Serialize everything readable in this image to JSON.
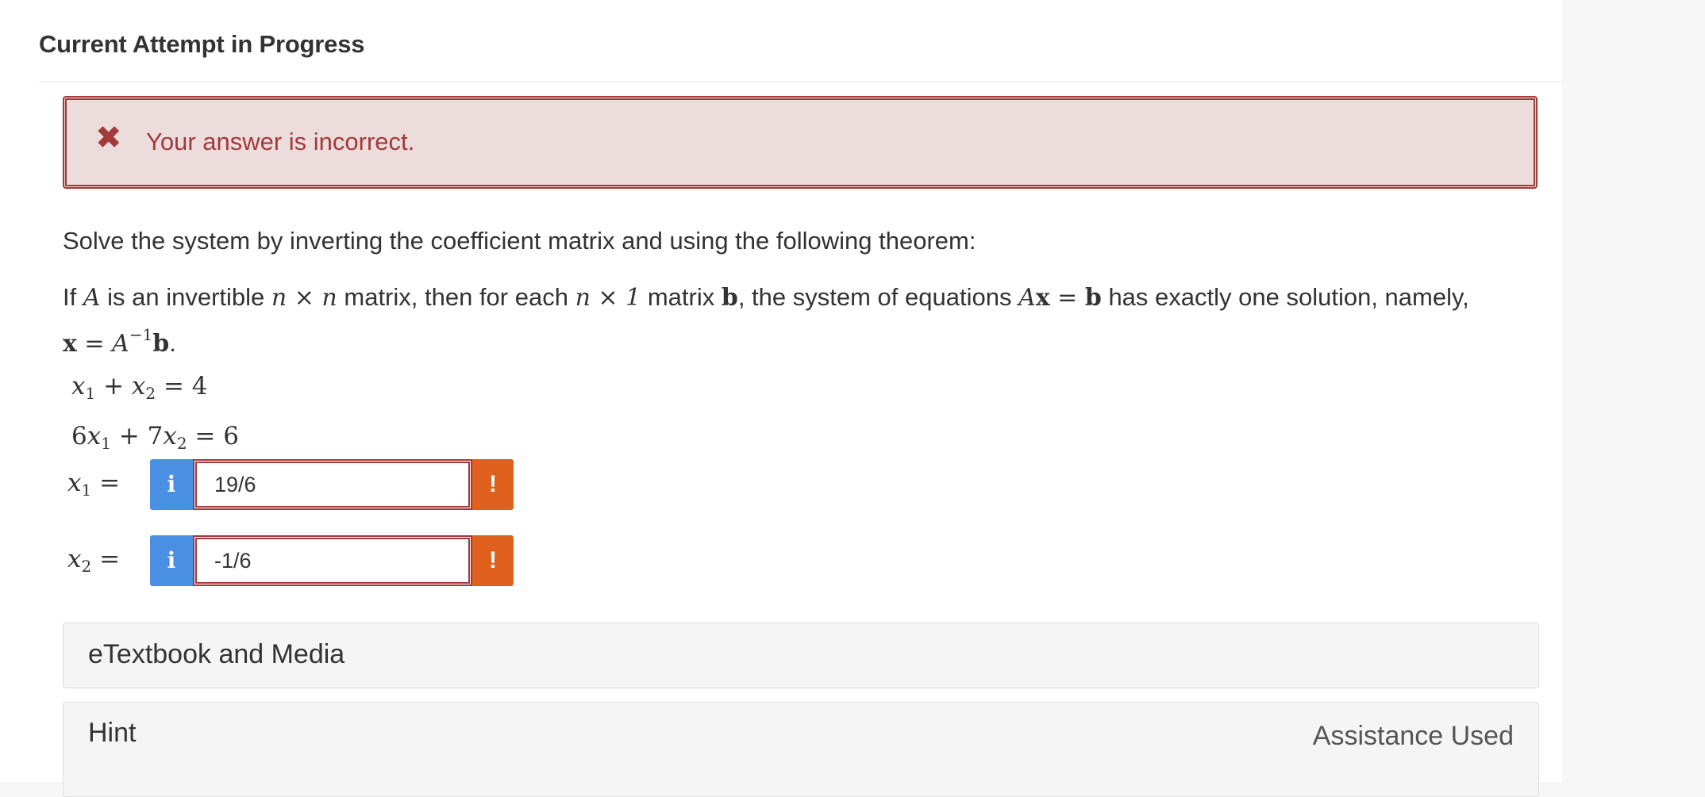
{
  "header": {
    "title": "Current Attempt in Progress"
  },
  "feedback": {
    "icon": "close-icon",
    "message": "Your answer is incorrect.",
    "color": "#a33a3a"
  },
  "question": {
    "prompt": "Solve the system by inverting the coefficient matrix and using the following theorem:",
    "theorem": {
      "t1": "If ",
      "A": "A",
      "t2": " is an invertible ",
      "nxn": "n × n",
      "t3": " matrix, then for each ",
      "nx1": "n × 1",
      "t4": " matrix ",
      "b": "b",
      "t5": ", the system of equations ",
      "Ax": "A",
      "xb": "x",
      "eq": " = ",
      "b2": "b",
      "t6": " has exactly one solution, namely,",
      "x": "x",
      "eq2": " = ",
      "Ainv": "A",
      "exp": "−1",
      "b3": "b",
      "t7": "."
    },
    "system": {
      "eq1_coef1": "x",
      "eq1_sub1": "1",
      "eq1_plus": " + ",
      "eq1_coef2": "x",
      "eq1_sub2": "2",
      "eq1_rhs": " = 4",
      "eq2_a": "6",
      "eq2_coef1": "x",
      "eq2_sub1": "1",
      "eq2_plus": " + 7",
      "eq2_coef2": "x",
      "eq2_sub2": "2",
      "eq2_rhs": " = 6"
    }
  },
  "answers": [
    {
      "var": "x",
      "sub": "1",
      "eq": " =",
      "info": "i",
      "value": "19/6",
      "alert": "!"
    },
    {
      "var": "x",
      "sub": "2",
      "eq": " =",
      "info": "i",
      "value": "-1/6",
      "alert": "!"
    }
  ],
  "panels": {
    "etextbook": "eTextbook and Media",
    "hint": "Hint",
    "assistance": "Assistance Used"
  },
  "colors": {
    "info": "#4a90e2",
    "alert": "#e0601e",
    "error_bg": "#eddcdc"
  }
}
